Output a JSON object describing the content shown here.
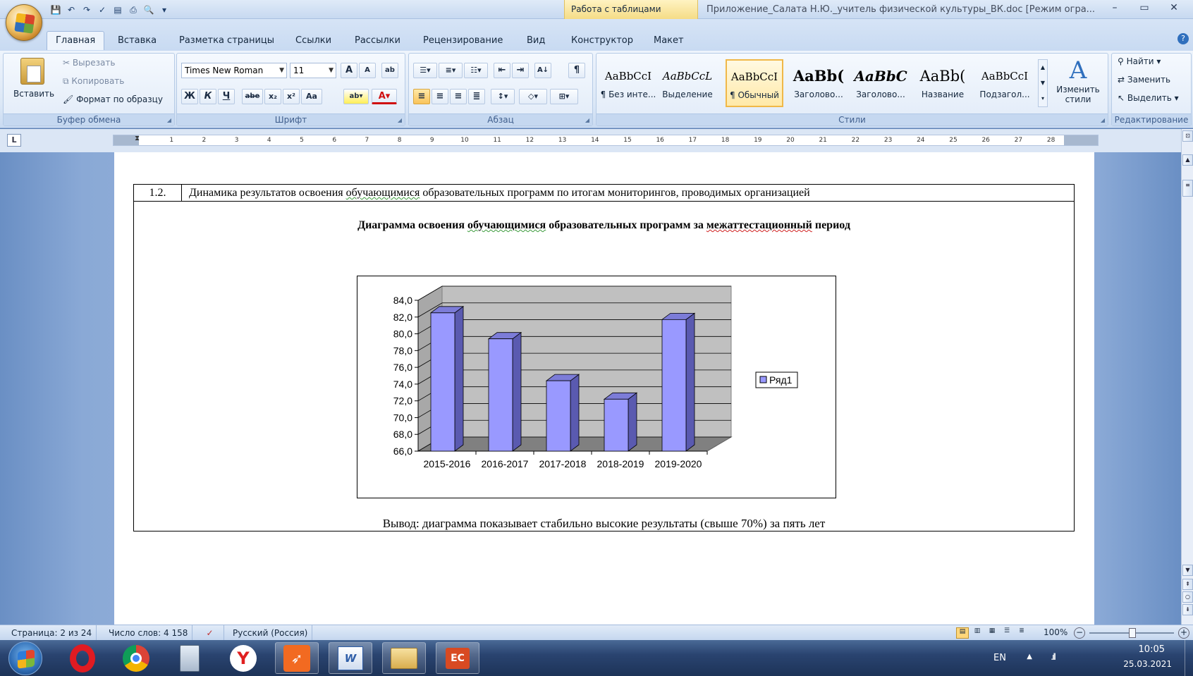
{
  "window": {
    "context_tab_title": "Работа с таблицами",
    "doc_title": "Приложение_Салата Н.Ю._учитель физической культуры_ВК.doc [Режим огра...",
    "controls": [
      "–",
      "▭",
      "✕"
    ]
  },
  "tabs": [
    "Главная",
    "Вставка",
    "Разметка страницы",
    "Ссылки",
    "Рассылки",
    "Рецензирование",
    "Вид",
    "Конструктор",
    "Макет"
  ],
  "ribbon": {
    "clipboard": {
      "paste": "Вставить",
      "cut": "Вырезать",
      "copy": "Копировать",
      "format_painter": "Формат по образцу",
      "label": "Буфер обмена"
    },
    "font": {
      "family": "Times New Roman",
      "size": "11",
      "bold": "Ж",
      "italic": "К",
      "underline": "Ч",
      "strike": "abe",
      "sub": "x₂",
      "sup": "x²",
      "case": "Aa",
      "label": "Шрифт"
    },
    "paragraph": {
      "label": "Абзац"
    },
    "styles": {
      "label": "Стили",
      "tiles": [
        {
          "sample": "AaBbCcI",
          "name": "¶ Без инте..."
        },
        {
          "sample": "AaBbCcL",
          "name": "Выделение"
        },
        {
          "sample": "AaBbCcI",
          "name": "¶ Обычный"
        },
        {
          "sample": "AaBb(",
          "name": "Заголово..."
        },
        {
          "sample": "AaBbC",
          "name": "Заголово..."
        },
        {
          "sample": "AaBb(",
          "name": "Название"
        },
        {
          "sample": "AaBbCcI",
          "name": "Подзагол..."
        }
      ],
      "change": "Изменить стили"
    },
    "editing": {
      "find": "Найти",
      "replace": "Заменить",
      "select": "Выделить",
      "label": "Редактирование"
    }
  },
  "ruler": {
    "numbers": [
      "1",
      "2",
      "3",
      "4",
      "5",
      "6",
      "7",
      "8",
      "9",
      "10",
      "11",
      "12",
      "13",
      "14",
      "15",
      "16",
      "17",
      "18",
      "19",
      "20",
      "21",
      "22",
      "23",
      "24",
      "25",
      "26",
      "27",
      "28"
    ]
  },
  "document": {
    "row_number": "1.2.",
    "row_heading_a": "Динамика результатов освоения ",
    "row_heading_b": "обучающимися",
    "row_heading_c": " образовательных программ по итогам мониторингов, проводимых организацией",
    "chart_title_a": "Диаграмма освоения ",
    "chart_title_b": "обучающимися",
    "chart_title_c": " образовательных программ за ",
    "chart_title_d": "межаттестационный",
    "chart_title_e": " период",
    "conclusion": "Вывод: диаграмма показывает стабильно высокие результаты (свыше 70%) за пять лет"
  },
  "chart_data": {
    "type": "bar",
    "categories": [
      "2015-2016",
      "2016-2017",
      "2017-2018",
      "2018-2019",
      "2019-2020"
    ],
    "series": [
      {
        "name": "Ряд1",
        "values": [
          82.5,
          79.4,
          74.4,
          72.2,
          81.7
        ]
      }
    ],
    "ylim": [
      66,
      84
    ],
    "yticks": [
      "66,0",
      "68,0",
      "70,0",
      "72,0",
      "74,0",
      "76,0",
      "78,0",
      "80,0",
      "82,0",
      "84,0"
    ],
    "grid": true,
    "legend": "right",
    "colors": {
      "bar_front": "#9999ff",
      "bar_side": "#5a5ab0",
      "bar_top": "#7c7cd8",
      "wall": "#c0c0c0",
      "floor": "#808080"
    }
  },
  "status": {
    "page": "Страница: 2 из 24",
    "words": "Число слов: 4 158",
    "lang": "Русский (Россия)",
    "zoom": "100%"
  },
  "taskbar": {
    "lang": "EN",
    "time": "10:05",
    "date": "25.03.2021"
  }
}
